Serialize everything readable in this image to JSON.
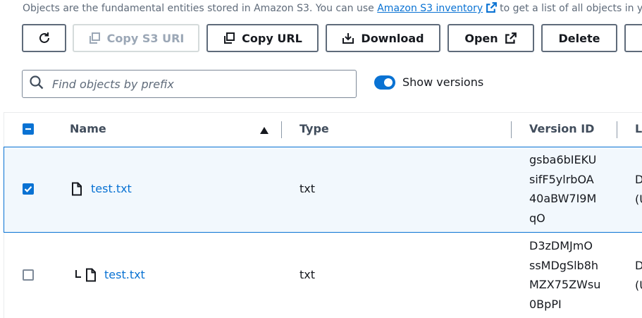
{
  "header": {
    "description_before": "Objects are the fundamental entities stored in Amazon S3. You can use",
    "inventory_link": "Amazon S3 inventory",
    "description_after": "to get a list of all objects in your"
  },
  "toolbar": {
    "refresh_icon": "refresh-icon",
    "copy_s3_uri": "Copy S3 URI",
    "copy_url": "Copy URL",
    "download": "Download",
    "open": "Open",
    "delete": "Delete"
  },
  "search": {
    "placeholder": "Find objects by prefix",
    "value": ""
  },
  "versions_toggle": {
    "label": "Show versions",
    "on": true
  },
  "table": {
    "columns": [
      "Name",
      "Type",
      "Version ID",
      "L"
    ],
    "sort": "ascending",
    "select_all": "indeterminate",
    "rows": [
      {
        "name": "test.txt",
        "type": "txt",
        "version_lines": [
          "gsba6bIEKU",
          "sifF5ylrbOA",
          "40aBW7I9M",
          "qO"
        ],
        "next_col": [
          "D",
          "(U"
        ],
        "selected": true,
        "is_child": false
      },
      {
        "name": "test.txt",
        "type": "txt",
        "version_lines": [
          "D3zDMJmO",
          "ssMDgSlb8h",
          "MZX75ZWsu",
          "0BpPI"
        ],
        "next_col": [
          "D",
          "(U"
        ],
        "selected": false,
        "is_child": true
      }
    ]
  },
  "colors": {
    "accent": "#0972d3",
    "selected_row_bg": "#f2f8fd",
    "border": "#5f6b7a",
    "disabled": "#9ba7b6"
  }
}
